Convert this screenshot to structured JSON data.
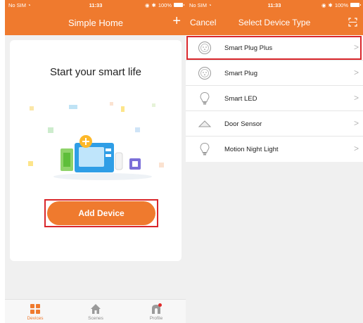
{
  "left": {
    "status": {
      "carrier": "No SIM",
      "time": "11:33",
      "battery": "100%"
    },
    "navbar": {
      "title": "Simple Home",
      "add_icon": "plus-icon"
    },
    "card": {
      "title": "Start your smart life",
      "add_button_label": "Add Device"
    },
    "tabs": [
      {
        "label": "Devices",
        "icon": "grid-icon",
        "active": true
      },
      {
        "label": "Scenes",
        "icon": "home-icon",
        "active": false
      },
      {
        "label": "Profile",
        "icon": "profile-icon",
        "active": false
      }
    ]
  },
  "right": {
    "status": {
      "carrier": "No SIM",
      "time": "11:33",
      "battery": "100%"
    },
    "navbar": {
      "cancel_label": "Cancel",
      "title": "Select Device Type",
      "scan_icon": "scan-icon"
    },
    "devices": [
      {
        "label": "Smart Plug Plus",
        "icon": "plug-icon",
        "highlighted": true
      },
      {
        "label": "Smart Plug",
        "icon": "plug-icon",
        "highlighted": false
      },
      {
        "label": "Smart LED",
        "icon": "bulb-icon",
        "highlighted": false
      },
      {
        "label": "Door Sensor",
        "icon": "door-sensor-icon",
        "highlighted": false
      },
      {
        "label": "Motion Night Light",
        "icon": "bulb-icon",
        "highlighted": false
      }
    ],
    "chevron": ">"
  },
  "colors": {
    "accent": "#ef7a2e",
    "highlight_frame": "#d9262b",
    "background": "#f0f0f0"
  }
}
